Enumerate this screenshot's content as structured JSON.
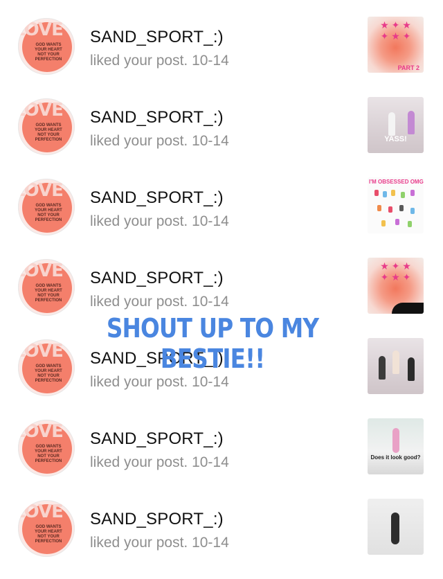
{
  "notifications": [
    {
      "username": "SAND_SPORT_:)",
      "action": "liked your post. 10-14",
      "avatar_text": "LOVE",
      "avatar_motto": "GOD WANTS YOUR HEART NOT YOUR PERFECTION",
      "thumb_caption": "PART 2"
    },
    {
      "username": "SAND_SPORT_:)",
      "action": "liked your post. 10-14",
      "avatar_text": "LOVE",
      "avatar_motto": "GOD WANTS YOUR HEART NOT YOUR PERFECTION",
      "thumb_caption": "YASS!"
    },
    {
      "username": "SAND_SPORT_:)",
      "action": "liked your post. 10-14",
      "avatar_text": "LOVE",
      "avatar_motto": "GOD WANTS YOUR HEART NOT YOUR PERFECTION",
      "thumb_caption": "I'M OBSESSED OMG"
    },
    {
      "username": "SAND_SPORT_:)",
      "action": "liked your post. 10-14",
      "avatar_text": "LOVE",
      "avatar_motto": "GOD WANTS YOUR HEART NOT YOUR PERFECTION",
      "thumb_caption": ""
    },
    {
      "username": "SAND_SPORT_:)",
      "action": "liked your post. 10-14",
      "avatar_text": "LOVE",
      "avatar_motto": "GOD WANTS YOUR HEART NOT YOUR PERFECTION",
      "thumb_caption": ""
    },
    {
      "username": "SAND_SPORT_:)",
      "action": "liked your post. 10-14",
      "avatar_text": "LOVE",
      "avatar_motto": "GOD WANTS YOUR HEART NOT YOUR PERFECTION",
      "thumb_caption": "Does it look good?"
    },
    {
      "username": "SAND_SPORT_:)",
      "action": "liked your post. 10-14",
      "avatar_text": "LOVE",
      "avatar_motto": "GOD WANTS YOUR HEART NOT YOUR PERFECTION",
      "thumb_caption": ""
    }
  ],
  "overlay_text": "SHOUT UP TO MY BESTIE!!",
  "colors": {
    "avatar_accent": "#f47f6b",
    "overlay": "#4a86e0",
    "secondary_text": "#8e8e8e"
  }
}
